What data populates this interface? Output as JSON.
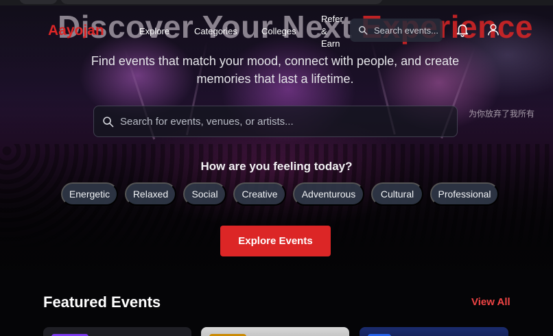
{
  "brand": {
    "name": "Aayojan",
    "color": "#dc2626"
  },
  "hero": {
    "headline_prefix": "Discover Your Next ",
    "headline_accent": "Experience",
    "subtitle": "Find events that match your mood, connect with people, and create memories that last a lifetime.",
    "search_placeholder": "Search for events, venues, or artists...",
    "overlay_text": "为你放弃了我所有"
  },
  "nav": {
    "links": [
      "Explore",
      "Categories",
      "Colleges",
      "Refer & Earn"
    ],
    "search_placeholder": "Search events...",
    "icons": [
      "search-icon",
      "bell-icon",
      "user-icon"
    ]
  },
  "moods": {
    "heading": "How are you feeling today?",
    "options": [
      "Energetic",
      "Relaxed",
      "Social",
      "Creative",
      "Adventurous",
      "Cultural",
      "Professional"
    ]
  },
  "cta": {
    "label": "Explore Events",
    "color": "#dc2626"
  },
  "featured": {
    "title": "Featured Events",
    "view_all": "View All",
    "view_all_color": "#ef4444"
  }
}
